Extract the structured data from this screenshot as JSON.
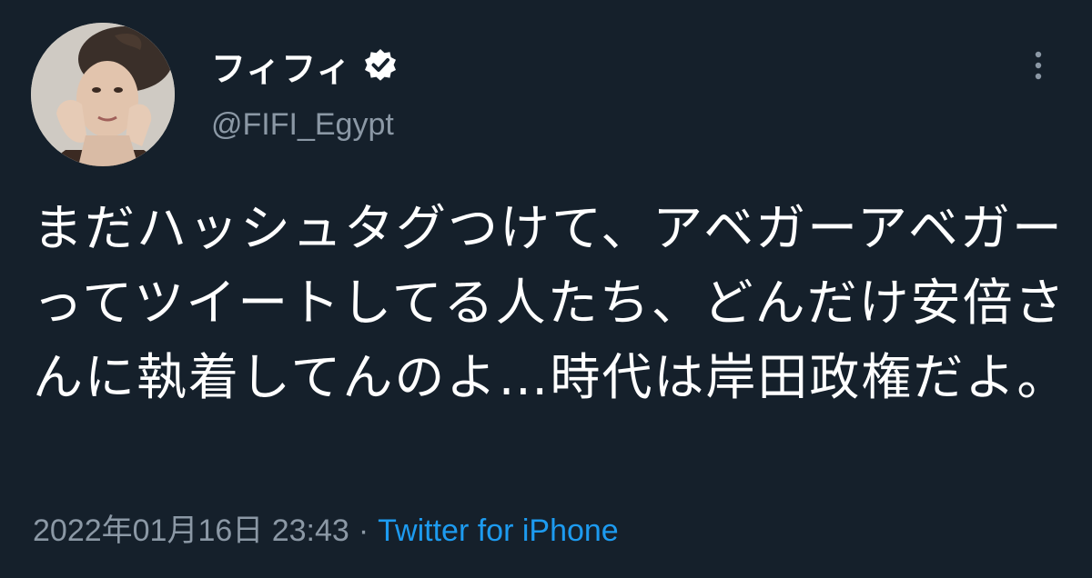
{
  "tweet": {
    "display_name": "フィフィ",
    "handle": "@FIFI_Egypt",
    "text": "まだハッシュタグつけて、アベガーアベガーってツイートしてる人たち、どんだけ安倍さんに執着してんのよ…時代は岸田政権だよ。",
    "date": "2022年01月16日",
    "time": "23:43",
    "separator": "·",
    "source": "Twitter for iPhone"
  },
  "icons": {
    "verified": "verified-badge-icon",
    "more": "more-vertical-icon"
  },
  "colors": {
    "background": "#15202b",
    "text": "#ffffff",
    "secondary_text": "#8b98a5",
    "link": "#1d9bf0"
  }
}
